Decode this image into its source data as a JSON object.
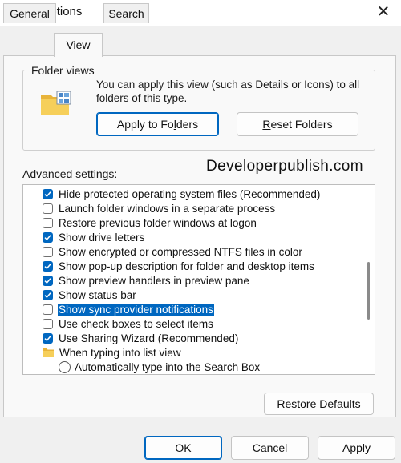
{
  "window": {
    "title": "Folder Options",
    "close_glyph": "✕"
  },
  "tabs": [
    {
      "label": "General",
      "active": false
    },
    {
      "label": "View",
      "active": true
    },
    {
      "label": "Search",
      "active": false
    }
  ],
  "folder_views": {
    "label": "Folder views",
    "description": "You can apply this view (such as Details or Icons) to all folders of this type.",
    "apply_button": {
      "pre": "Apply to Fo",
      "mnemonic": "l",
      "post": "ders"
    },
    "reset_button": {
      "pre": "",
      "mnemonic": "R",
      "post": "eset Folders"
    },
    "icon": "folder-view-icon"
  },
  "advanced": {
    "label": "Advanced settings:",
    "items": [
      {
        "label": "Hide protected operating system files (Recommended)",
        "type": "checkbox",
        "checked": true
      },
      {
        "label": "Launch folder windows in a separate process",
        "type": "checkbox",
        "checked": false
      },
      {
        "label": "Restore previous folder windows at logon",
        "type": "checkbox",
        "checked": false
      },
      {
        "label": "Show drive letters",
        "type": "checkbox",
        "checked": true
      },
      {
        "label": "Show encrypted or compressed NTFS files in color",
        "type": "checkbox",
        "checked": false
      },
      {
        "label": "Show pop-up description for folder and desktop items",
        "type": "checkbox",
        "checked": true
      },
      {
        "label": "Show preview handlers in preview pane",
        "type": "checkbox",
        "checked": true
      },
      {
        "label": "Show status bar",
        "type": "checkbox",
        "checked": true
      },
      {
        "label": "Show sync provider notifications",
        "type": "checkbox",
        "checked": false,
        "selected": true
      },
      {
        "label": "Use check boxes to select items",
        "type": "checkbox",
        "checked": false
      },
      {
        "label": "Use Sharing Wizard (Recommended)",
        "type": "checkbox",
        "checked": true
      },
      {
        "label": "When typing into list view",
        "type": "folder"
      },
      {
        "label": "Automatically type into the Search Box",
        "type": "radio",
        "checked": false
      }
    ]
  },
  "watermark": "Developerpublish.com",
  "restore_defaults": {
    "pre": "Restore ",
    "mnemonic": "D",
    "post": "efaults"
  },
  "footer": {
    "ok": "OK",
    "cancel": "Cancel",
    "apply": {
      "pre": "",
      "mnemonic": "A",
      "post": "pply"
    }
  },
  "colors": {
    "accent": "#0067c0",
    "folder_yellow": "#f2c440"
  }
}
